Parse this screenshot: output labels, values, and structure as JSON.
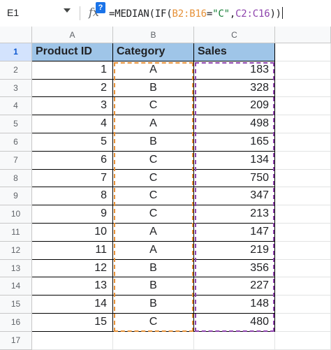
{
  "formula_bar": {
    "cell_ref": "E1",
    "fx": "fx",
    "help": "?",
    "formula_parts": [
      {
        "text": "=MEDIAN(IF(",
        "color": "black"
      },
      {
        "text": "B2:B16",
        "color": "orange"
      },
      {
        "text": "=",
        "color": "black"
      },
      {
        "text": "\"C\"",
        "color": "green"
      },
      {
        "text": ",",
        "color": "black"
      },
      {
        "text": "C2:C16",
        "color": "purple"
      },
      {
        "text": "))",
        "color": "black"
      }
    ]
  },
  "column_headers": [
    "A",
    "B",
    "C"
  ],
  "row_numbers": [
    "1",
    "2",
    "3",
    "4",
    "5",
    "6",
    "7",
    "8",
    "9",
    "10",
    "11",
    "12",
    "13",
    "14",
    "15",
    "16",
    "17"
  ],
  "table": {
    "headers": [
      "Product ID",
      "Category",
      "Sales"
    ],
    "rows": [
      [
        "1",
        "A",
        "183"
      ],
      [
        "2",
        "B",
        "328"
      ],
      [
        "3",
        "C",
        "209"
      ],
      [
        "4",
        "A",
        "498"
      ],
      [
        "5",
        "B",
        "165"
      ],
      [
        "6",
        "C",
        "134"
      ],
      [
        "7",
        "C",
        "750"
      ],
      [
        "8",
        "C",
        "347"
      ],
      [
        "9",
        "C",
        "213"
      ],
      [
        "10",
        "A",
        "147"
      ],
      [
        "11",
        "A",
        "219"
      ],
      [
        "12",
        "B",
        "356"
      ],
      [
        "13",
        "B",
        "227"
      ],
      [
        "14",
        "B",
        "148"
      ],
      [
        "15",
        "C",
        "480"
      ]
    ]
  },
  "colors": {
    "header_fill": "#9fc5e8",
    "range_orange": "#e69138",
    "range_purple": "#8e44ad",
    "selected_row_header": "#d3e3fd"
  }
}
